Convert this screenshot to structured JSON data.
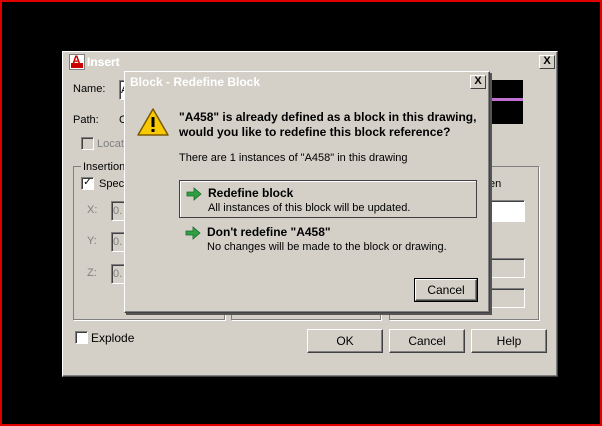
{
  "insert_dialog": {
    "title": "Insert",
    "name_label": "Name:",
    "name_value_fragment": "A",
    "path_label": "Path:",
    "path_value_fragment": "C",
    "locate_label": "Locat",
    "insertion_group": "Insertion",
    "specify_label": "Spec",
    "x_label": "X:",
    "y_label": "Y:",
    "z_label": "Z:",
    "coord_fragment": "0.",
    "screen_fragment": "en",
    "explode_label": "Explode",
    "ok_label": "OK",
    "cancel_label": "Cancel",
    "help_label": "Help",
    "close_glyph": "X"
  },
  "redefine_dialog": {
    "title": "Block - Redefine Block",
    "heading_line1": "\"A458\" is already defined as a block in this drawing,",
    "heading_line2": "would you like to redefine this block reference?",
    "instances_text": "There are 1 instances of \"A458\" in this drawing",
    "option1_title": "Redefine block",
    "option1_desc": "All instances of this block will be updated.",
    "option2_title": "Don't redefine \"A458\"",
    "option2_desc": "No changes will be made to the block or drawing.",
    "cancel_label": "Cancel",
    "close_glyph": "X"
  },
  "colors": {
    "dialog_bg": "#d4d0c8",
    "frame_border": "#e00000",
    "preview_line": "#c070d0",
    "arrow_green": "#2ea043"
  },
  "icons": [
    "autocad-icon",
    "close-icon",
    "warning-icon",
    "green-arrow-icon"
  ]
}
